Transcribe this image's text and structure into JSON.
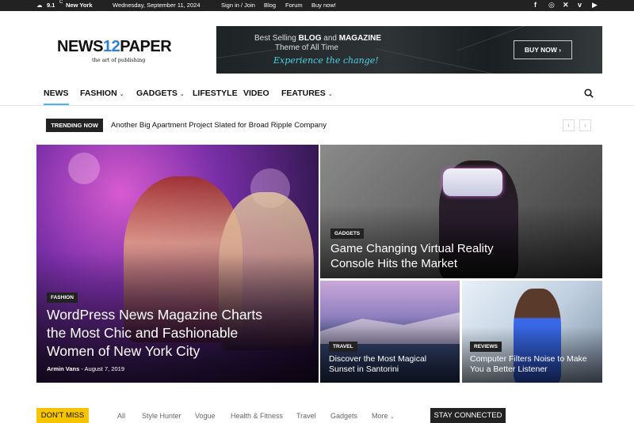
{
  "topbar": {
    "weather_temp": "9.1",
    "weather_unit": "C",
    "location": "New York",
    "date": "Wednesday, September 11, 2024",
    "links": [
      "Sign in / Join",
      "Blog",
      "Forum",
      "Buy now!"
    ],
    "social_icons": [
      "facebook-icon",
      "instagram-icon",
      "x-icon",
      "vimeo-icon",
      "youtube-icon"
    ]
  },
  "logo": {
    "word_left": "NEWS",
    "number": "12",
    "word_right": "PAPER",
    "tagline": "the art of publishing"
  },
  "banner": {
    "line1_prefix": "Best Selling",
    "line1_bold": "BLOG",
    "line1_mid": "and",
    "line1_bold2": "MAGAZINE",
    "line2": "Theme of All Time",
    "line3": "Experience the change!",
    "button": "BUY NOW"
  },
  "nav": {
    "items": [
      {
        "label": "NEWS",
        "dropdown": false,
        "active": true
      },
      {
        "label": "FASHION",
        "dropdown": true
      },
      {
        "label": "GADGETS",
        "dropdown": true
      },
      {
        "label": "LIFESTYLE",
        "dropdown": false
      },
      {
        "label": "VIDEO",
        "dropdown": false
      },
      {
        "label": "FEATURES",
        "dropdown": true
      }
    ]
  },
  "trending": {
    "label": "TRENDING NOW",
    "headline": "Another Big Apartment Project Slated for Broad Ripple Company"
  },
  "featured": {
    "main": {
      "category": "FASHION",
      "title_lines": [
        "WordPress News Magazine Charts",
        "the Most Chic and Fashionable",
        "Women of New York City"
      ],
      "author": "Armin Vans",
      "date": "August 7, 2019"
    },
    "top_right": {
      "category": "GADGETS",
      "title_lines": [
        "Game Changing Virtual Reality",
        "Console Hits the Market"
      ]
    },
    "bottom_left": {
      "category": "TRAVEL",
      "title_lines": [
        "Discover the Most Magical",
        "Sunset in Santorini"
      ]
    },
    "bottom_right": {
      "category": "REVIEWS",
      "title_lines": [
        "Computer Filters Noise to Make",
        "You a Better Listener"
      ]
    }
  },
  "bottom": {
    "dont_miss": "DON'T MISS",
    "filters": [
      "All",
      "Style Hunter",
      "Vogue",
      "Health & Fitness",
      "Travel",
      "Gadgets",
      "More"
    ],
    "stay_connected": "STAY CONNECTED"
  },
  "colors": {
    "accent": "#4db2ec",
    "dont_miss": "#f7c400",
    "logo_number": "#2f7fd8"
  }
}
